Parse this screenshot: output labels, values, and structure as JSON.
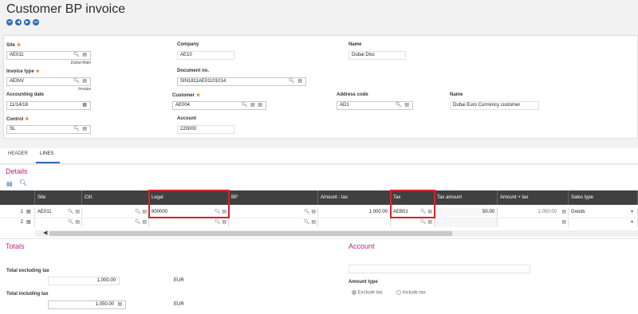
{
  "page": {
    "title": "Customer BP invoice"
  },
  "nav": {
    "first": "⏮",
    "prev": "◀",
    "next": "▶",
    "last": "⏭"
  },
  "header": {
    "site": {
      "label": "Site",
      "value": "AE011",
      "sub": "Dubai Main"
    },
    "company": {
      "label": "Company",
      "value": "AE10"
    },
    "company_name": {
      "label": "Name",
      "value": "Dubai Disc"
    },
    "invoice_type": {
      "label": "Invoice type",
      "value": "AEINV",
      "sub": "Invoice"
    },
    "document_no": {
      "label": "Document no.",
      "value": "SIN1811AE01101014"
    },
    "accounting_date": {
      "label": "Accounting date",
      "value": "11/14/18"
    },
    "customer": {
      "label": "Customer",
      "value": "AE004"
    },
    "address_code": {
      "label": "Address code",
      "value": "AD1"
    },
    "customer_name": {
      "label": "Name",
      "value": "Dubai Euro Currrency customer"
    },
    "control": {
      "label": "Control",
      "value": "SL"
    },
    "account": {
      "label": "Account",
      "value": "220000"
    }
  },
  "tabs": [
    {
      "label": "HEADER"
    },
    {
      "label": "LINES"
    }
  ],
  "details": {
    "title": "Details",
    "columns": [
      "Site",
      "Ctrl.",
      "Legal",
      "BP",
      "Amount - tax",
      "Tax",
      "Tax amount",
      "Amount + tax",
      "Sales type"
    ],
    "rows": [
      {
        "num": "1",
        "site": "AE011",
        "ctrl": "",
        "legal": "600000",
        "bp": "",
        "amount_tax": "1,000.00",
        "tax": "AEB01",
        "tax_amount": "50.00",
        "amount_plus_tax": "1,050.00",
        "sales_type": "Goods"
      },
      {
        "num": "2",
        "site": "",
        "ctrl": "",
        "legal": "",
        "bp": "",
        "amount_tax": "",
        "tax": "",
        "tax_amount": "",
        "amount_plus_tax": "",
        "sales_type": ""
      }
    ]
  },
  "totals": {
    "title": "Totals",
    "excl_label": "Total excluding tax",
    "excl_value": "1,000.00",
    "excl_currency": "EUR",
    "incl_label": "Total including tax",
    "incl_value": "1,050.00",
    "incl_currency": "EUR"
  },
  "account_section": {
    "title": "Account",
    "amount_type_label": "Amount type",
    "option_exclude": "Exclude tax",
    "option_include": "Include tax"
  },
  "colors": {
    "accent": "#2b6cb6",
    "section_title": "#c0227c",
    "grid_header": "#404040",
    "highlight": "#d8222a",
    "required": "#f07a1a"
  }
}
